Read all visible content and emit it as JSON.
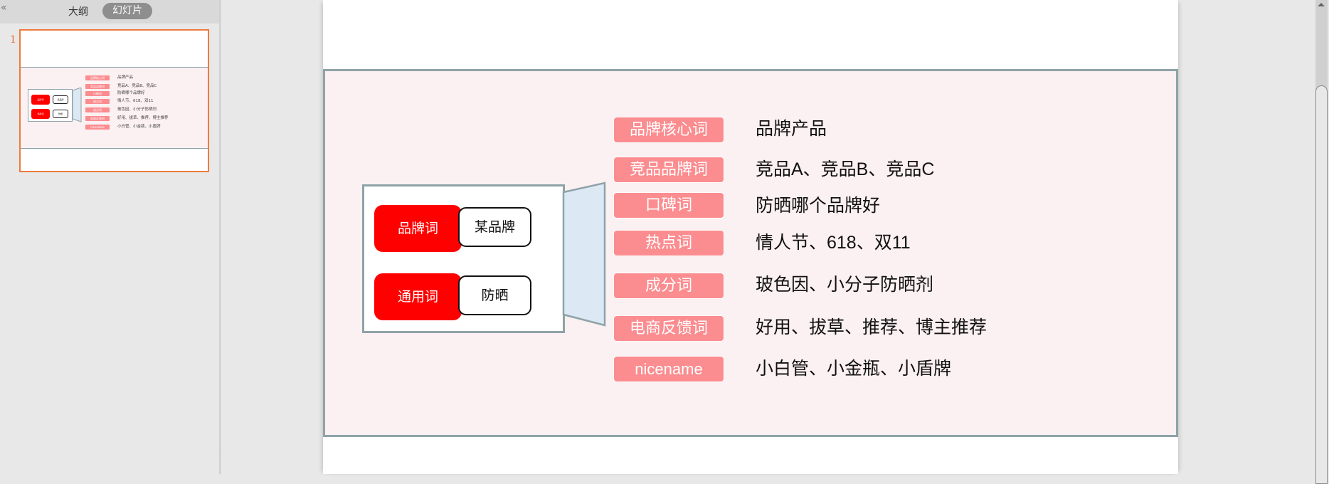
{
  "sidebar": {
    "collapse_icon": "«",
    "tabs": [
      {
        "label": "大纲",
        "active": false
      },
      {
        "label": "幻灯片",
        "active": true
      }
    ],
    "slides": [
      {
        "number": "1",
        "selected": true
      }
    ]
  },
  "slide": {
    "diagram": {
      "rows": [
        {
          "category": "品牌词",
          "example": "某品牌"
        },
        {
          "category": "通用词",
          "example": "防晒"
        }
      ]
    },
    "keywords": [
      {
        "tag": "品牌核心词",
        "value": "品牌产品"
      },
      {
        "tag": "竞品品牌词",
        "value": "竞品A、竞品B、竞品C"
      },
      {
        "tag": "口碑词",
        "value": "防晒哪个品牌好"
      },
      {
        "tag": "热点词",
        "value": "情人节、618、双11"
      },
      {
        "tag": "成分词",
        "value": "玻色因、小分子防晒剂"
      },
      {
        "tag": "电商反馈词",
        "value": "好用、拔草、推荐、博主推荐"
      },
      {
        "tag": "nicename",
        "value": "小白管、小金瓶、小盾牌"
      }
    ]
  },
  "colors": {
    "selection_accent": "#ef7a3e",
    "red_pill": "#ff0000",
    "tag_pink": "#fb8c8f",
    "band_bg": "#fbf0f2",
    "border_gray": "#8ea3a8",
    "funnel_fill": "#dce8f4"
  }
}
